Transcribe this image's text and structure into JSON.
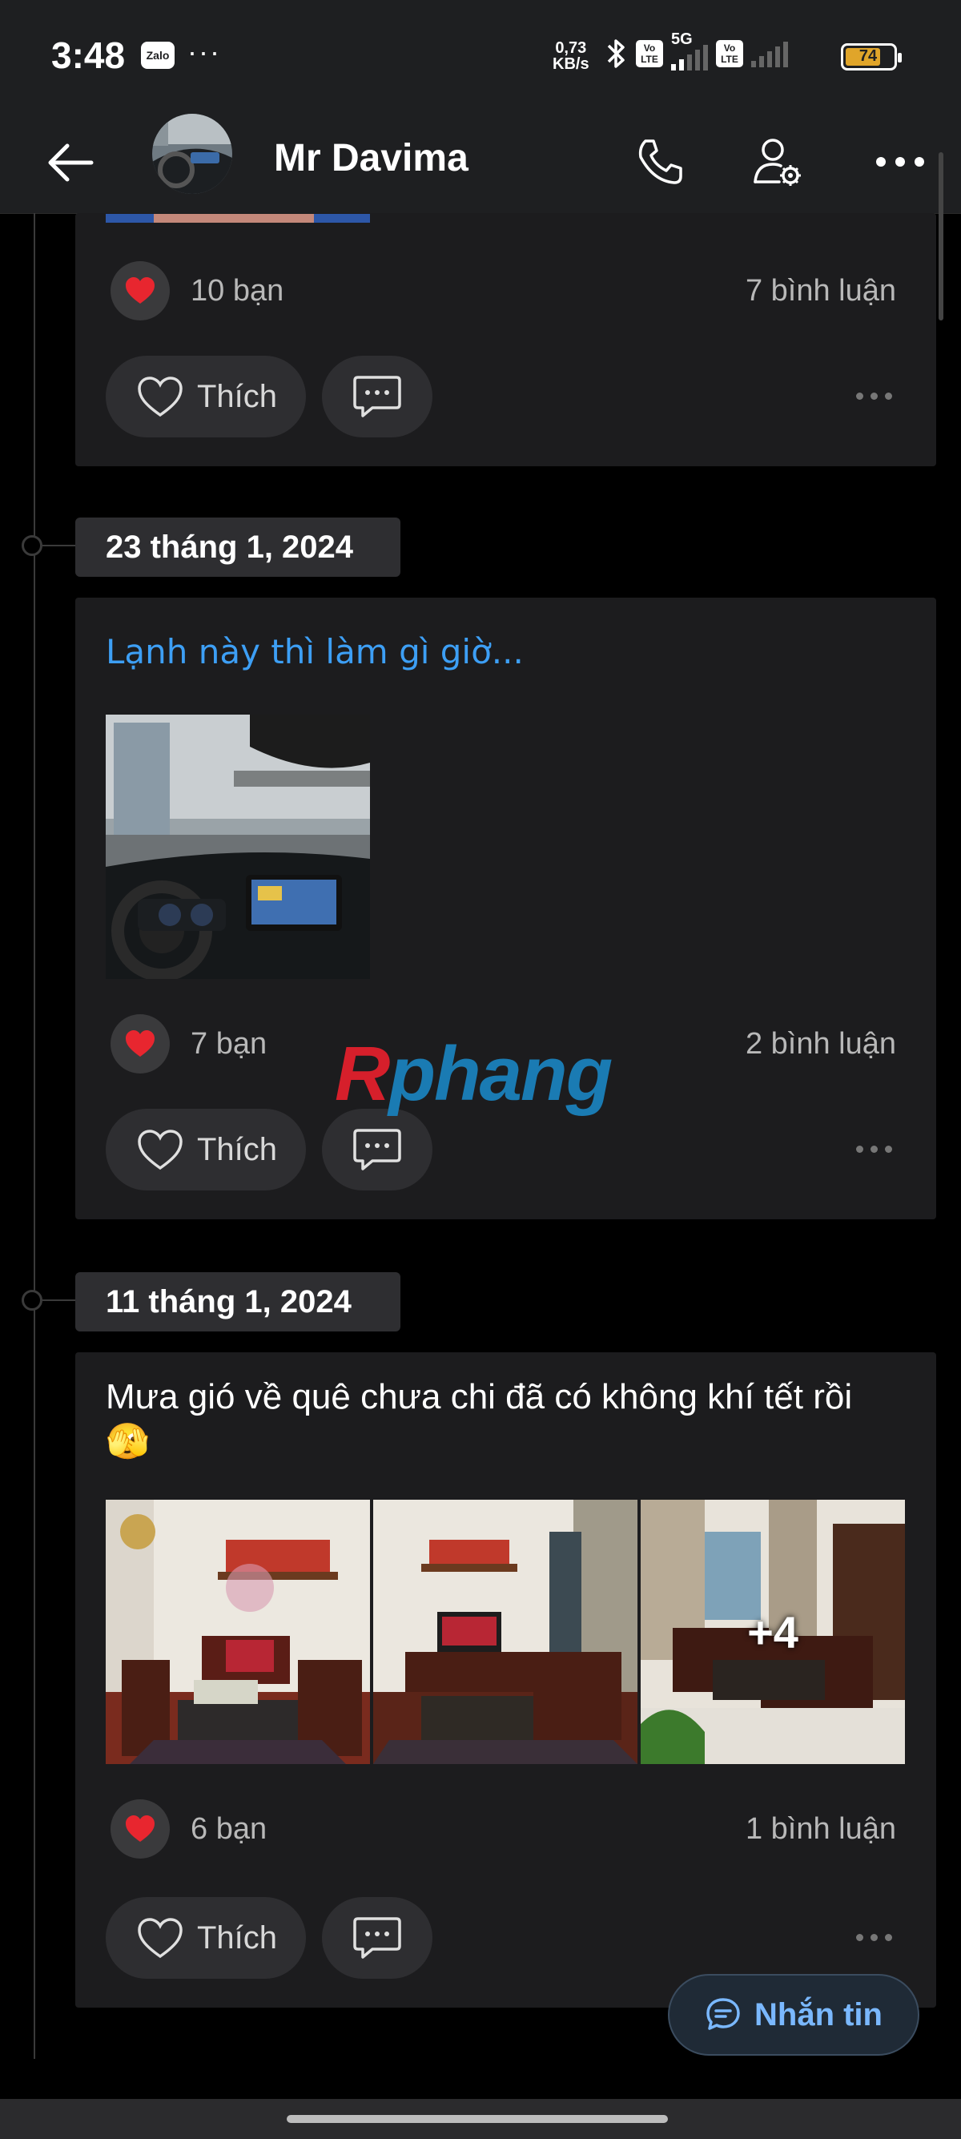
{
  "status_bar": {
    "time": "3:48",
    "zalo_badge": "Zalo",
    "more": "···",
    "net_speed_value": "0,73",
    "net_speed_unit": "KB/s",
    "network_5g": "5G",
    "volte_label": "Vo LTE",
    "battery": "74",
    "battery_color": "#e0a52a"
  },
  "header": {
    "title": "Mr Davima",
    "back_icon": "back-arrow-icon",
    "call_icon": "phone-icon",
    "settings_icon": "user-settings-icon",
    "more_icon": "more-horizontal-icon"
  },
  "posts": [
    {
      "date": "",
      "likes": "10 bạn",
      "comments": "7 bình luận",
      "like_label": "Thích"
    },
    {
      "date": "23 tháng 1, 2024",
      "text": "Lạnh này thì làm gì giờ...",
      "text_color": "#3d9ff5",
      "likes": "7 bạn",
      "comments": "2 bình luận",
      "like_label": "Thích"
    },
    {
      "date": "11 tháng 1, 2024",
      "text_line1": "Mưa gió về quê chưa chi đã có không khí tết rồi",
      "text_line2": "🫣",
      "more_photos": "+4",
      "likes": "6 bạn",
      "comments": "1 bình luận",
      "like_label": "Thích"
    }
  ],
  "watermark": {
    "first": "R",
    "rest": "phang"
  },
  "message_button": {
    "label": "Nhắn tin"
  },
  "colors": {
    "accent": "#3d9ff5",
    "heart": "#e8262f",
    "background": "#000000",
    "card": "#1c1c1e"
  }
}
